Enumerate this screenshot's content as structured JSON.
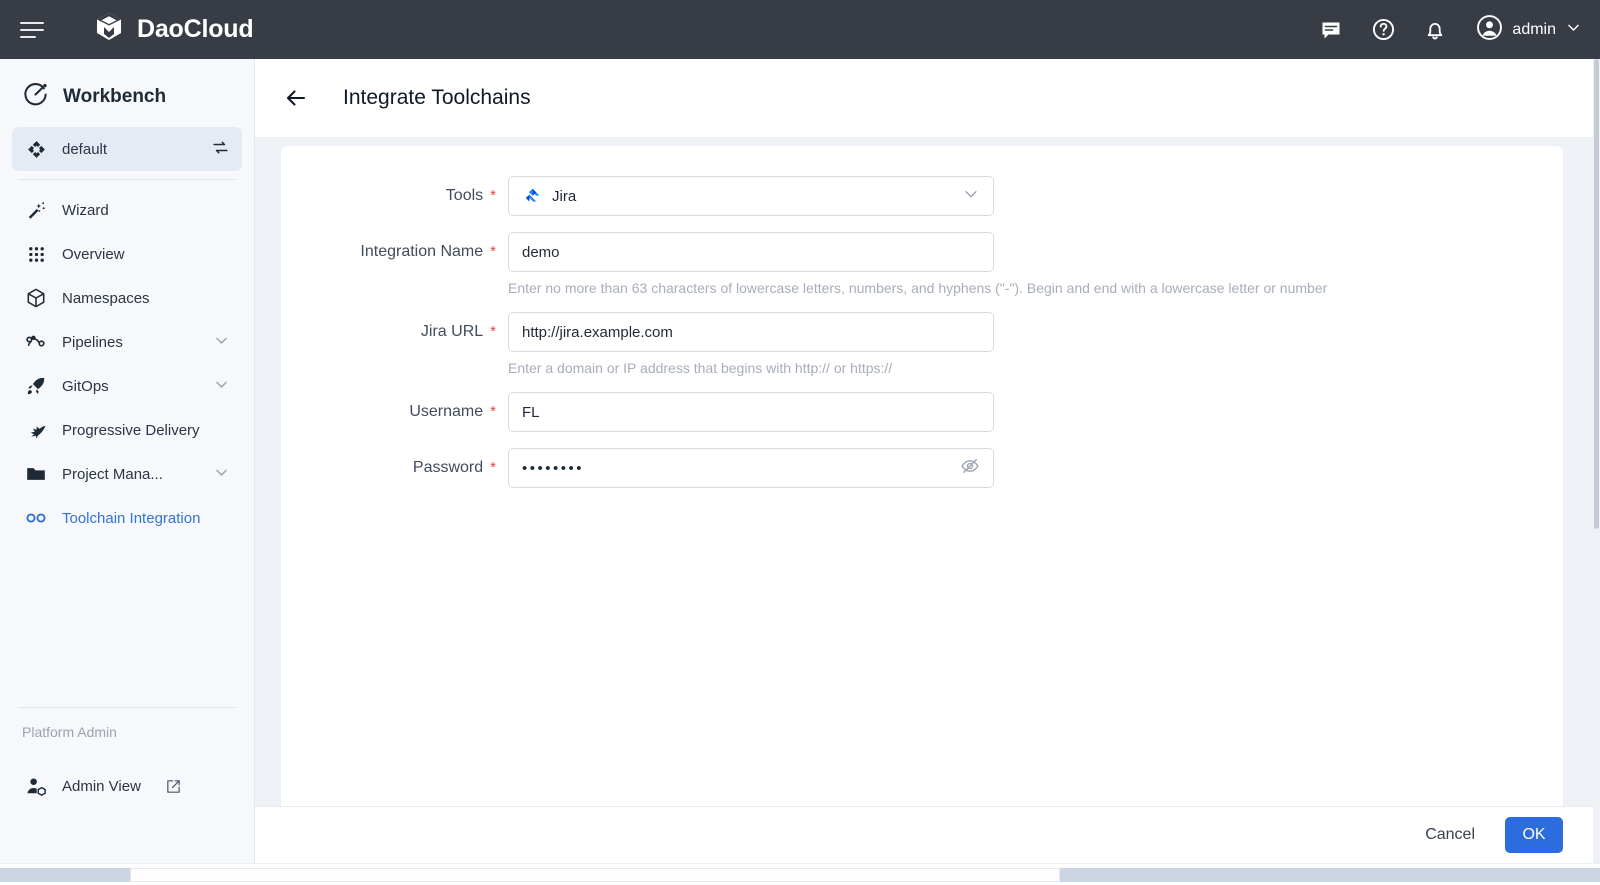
{
  "topbar": {
    "brand": "DaoCloud",
    "menu_icon": "hamburger-icon",
    "icons": [
      "message-icon",
      "help-icon",
      "bell-icon"
    ],
    "user": "admin",
    "chevron": "chevron-down-icon",
    "background": "#383d45"
  },
  "sidebar": {
    "workbench_title": "Workbench",
    "workbench_icon": "compass-icon",
    "active_item": "Toolchain Integration",
    "items": [
      {
        "label": "default",
        "icon": "cluster-icon",
        "trailing_icon": "switch-icon",
        "state": "selected-box"
      },
      {
        "label": "Wizard",
        "icon": "wand-icon",
        "state": "normal"
      },
      {
        "label": "Overview",
        "icon": "grid-dots-icon",
        "state": "normal"
      },
      {
        "label": "Namespaces",
        "icon": "cube-icon",
        "state": "normal"
      },
      {
        "label": "Pipelines",
        "icon": "pipeline-icon",
        "trailing_icon": "chevron-down-icon",
        "state": "normal"
      },
      {
        "label": "GitOps",
        "icon": "rocket-icon",
        "trailing_icon": "chevron-down-icon",
        "state": "normal"
      },
      {
        "label": "Progressive Delivery",
        "icon": "bird-icon",
        "state": "normal"
      },
      {
        "label": "Project Mana...",
        "icon": "folder-icon",
        "trailing_icon": "chevron-down-icon",
        "state": "normal"
      },
      {
        "label": "Toolchain Integration",
        "icon": "infinity-icon",
        "state": "active-link"
      }
    ],
    "section_label": "Platform Admin",
    "admin_item": {
      "label": "Admin View",
      "icon": "admin-user-icon",
      "trailing_icon": "external-link-icon"
    }
  },
  "page": {
    "back_icon": "arrow-left-icon",
    "title": "Integrate Toolchains"
  },
  "form": {
    "fields": [
      {
        "label": "Tools",
        "required": true,
        "type": "select",
        "value": "Jira",
        "icon": "jira-icon",
        "chevron": "chevron-down-icon",
        "helper": ""
      },
      {
        "label": "Integration Name",
        "required": true,
        "type": "text",
        "value": "demo",
        "helper": "Enter no more than 63 characters of lowercase letters, numbers, and hyphens (\"-\"). Begin and end with a lowercase letter or number"
      },
      {
        "label": "Jira URL",
        "required": true,
        "type": "text",
        "value": "http://jira.example.com",
        "helper": "Enter a domain or IP address that begins with http:// or https://"
      },
      {
        "label": "Username",
        "required": true,
        "type": "text",
        "value": "FL",
        "helper": ""
      },
      {
        "label": "Password",
        "required": true,
        "type": "password",
        "value": "••••••••",
        "toggle_icon": "eye-off-icon",
        "helper": ""
      }
    ],
    "required_marker": "*"
  },
  "footer": {
    "cancel_label": "Cancel",
    "ok_label": "OK",
    "ok_color": "#2d6cdf"
  }
}
